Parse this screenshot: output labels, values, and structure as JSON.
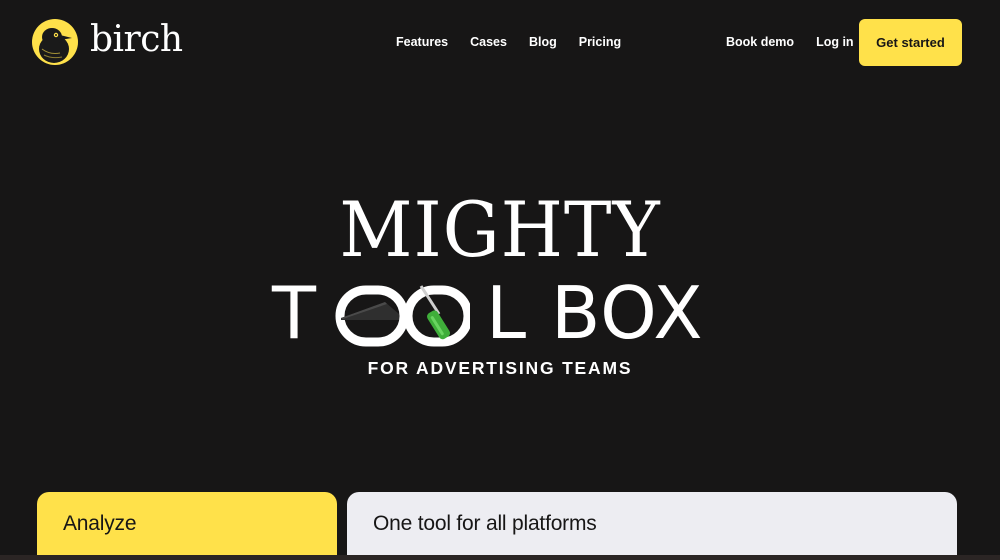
{
  "brand": {
    "name": "birch",
    "accent": "#ffe14a",
    "background": "#171616",
    "logo_icon": "bird-icon"
  },
  "nav": {
    "items": [
      "Features",
      "Cases",
      "Blog",
      "Pricing"
    ]
  },
  "header_actions": {
    "book_demo": "Book demo",
    "log_in": "Log in",
    "get_started": "Get started"
  },
  "hero": {
    "line1": "MIGHTY",
    "line2_part1": "T",
    "line2_part2": "L BOX",
    "subtitle": "FOR ADVERTISING TEAMS",
    "art_icons": [
      "wedge-icon",
      "screwdriver-icon"
    ]
  },
  "cards": [
    {
      "title": "Analyze",
      "color": "#ffe14a"
    },
    {
      "title": "One tool for all platforms",
      "color": "#ededf2"
    }
  ]
}
